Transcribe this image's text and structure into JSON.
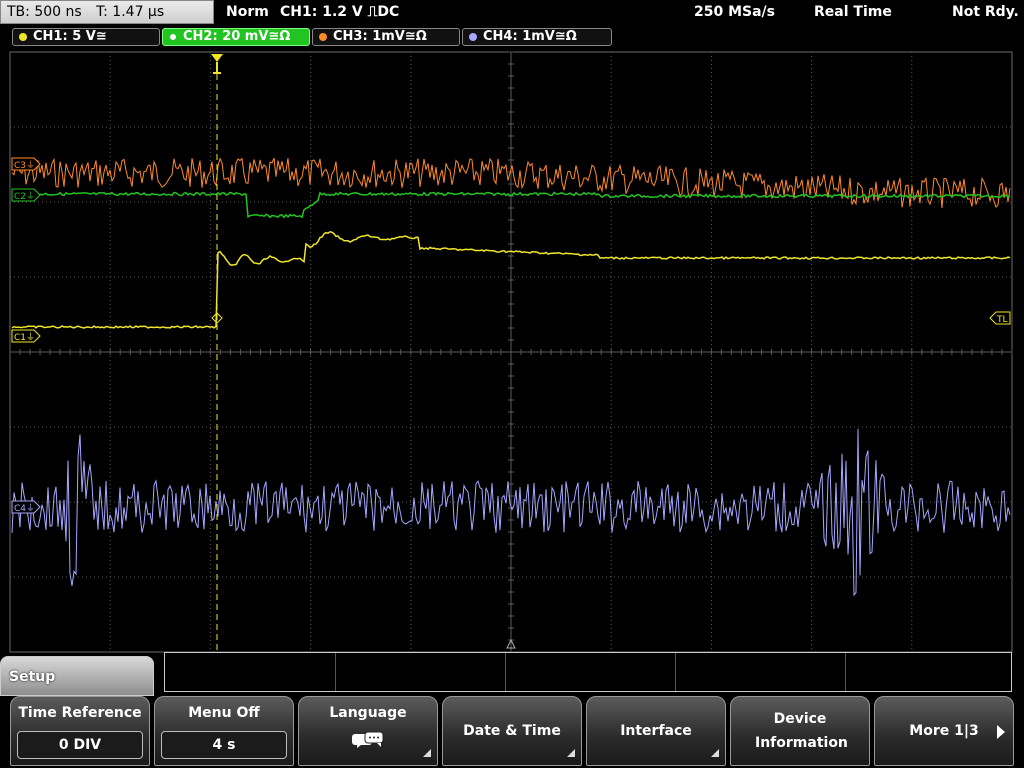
{
  "status": {
    "timebase": "TB: 500 ns",
    "trigger_time": "T: 1.47 µs",
    "trigger_mode": "Norm",
    "trigger_setting": "CH1: 1.2 V ⎍DC",
    "sample_rate": "250 MSa/s",
    "acq_mode": "Real Time",
    "ready_state": "Not Rdy."
  },
  "channels": [
    {
      "label": "CH1: 5 V≅",
      "color": "#f0e628",
      "active": false
    },
    {
      "label": "CH2: 20 mV≅Ω",
      "color": "#22c422",
      "active": true
    },
    {
      "label": "CH3: 1mV≅Ω",
      "color": "#ff8a2a",
      "active": false
    },
    {
      "label": "CH4: 1mV≅Ω",
      "color": "#a6a6ff",
      "active": false
    }
  ],
  "markers": {
    "c1": "C1⏚",
    "c2": "C2⏚",
    "c3": "C3⏚",
    "c4": "C4⏚",
    "trigger_level": "TL"
  },
  "menu": {
    "title": "Setup",
    "softkeys": [
      {
        "label": "Time Reference",
        "value": "0 DIV"
      },
      {
        "label": "Menu Off",
        "value": "4 s"
      },
      {
        "label": "Language",
        "icon": "speech-bubble-icon"
      },
      {
        "label": "Date & Time"
      },
      {
        "label": "Interface"
      },
      {
        "label": "Device Information"
      },
      {
        "label": "More 1|3"
      }
    ]
  },
  "colors": {
    "ch1": "#f0e628",
    "ch2": "#22c422",
    "ch3": "#ff8a2a",
    "ch4": "#a6a6ff",
    "grid": "#5a5a5a",
    "trigger_marker": "#f0e628"
  }
}
